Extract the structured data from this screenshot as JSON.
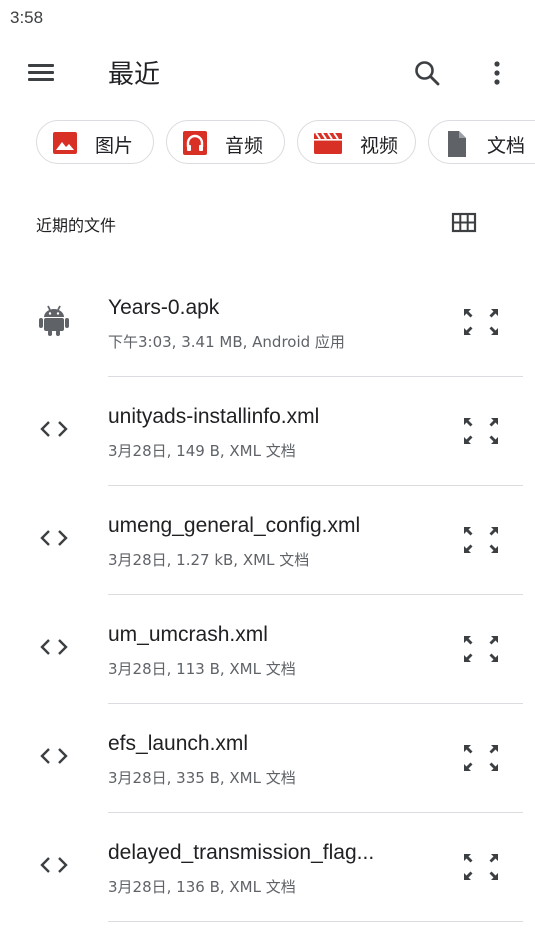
{
  "status_bar": {
    "time": "3:58"
  },
  "app_bar": {
    "title": "最近",
    "menu_icon": "hamburger-menu-icon",
    "search_icon": "search-icon",
    "more_icon": "more-vert-icon"
  },
  "chips": [
    {
      "label": "图片",
      "icon": "image-icon",
      "color": "#d93025"
    },
    {
      "label": "音频",
      "icon": "headphones-icon",
      "color": "#d93025"
    },
    {
      "label": "视频",
      "icon": "movie-icon",
      "color": "#d93025"
    },
    {
      "label": "文档",
      "icon": "document-icon",
      "color": "#5f6368"
    }
  ],
  "section": {
    "title": "近期的文件",
    "view_toggle_icon": "grid-view-icon"
  },
  "files": [
    {
      "name": "Years-0.apk",
      "meta": "下午3:03, 3.41 MB, Android 应用",
      "icon": "android-icon"
    },
    {
      "name": "unityads-installinfo.xml",
      "meta": "3月28日, 149 B, XML 文档",
      "icon": "code-icon"
    },
    {
      "name": "umeng_general_config.xml",
      "meta": "3月28日, 1.27 kB, XML 文档",
      "icon": "code-icon"
    },
    {
      "name": "um_umcrash.xml",
      "meta": "3月28日, 113 B, XML 文档",
      "icon": "code-icon"
    },
    {
      "name": "efs_launch.xml",
      "meta": "3月28日, 335 B, XML 文档",
      "icon": "code-icon"
    },
    {
      "name": "delayed_transmission_flag...",
      "meta": "3月28日, 136 B, XML 文档",
      "icon": "code-icon"
    }
  ]
}
